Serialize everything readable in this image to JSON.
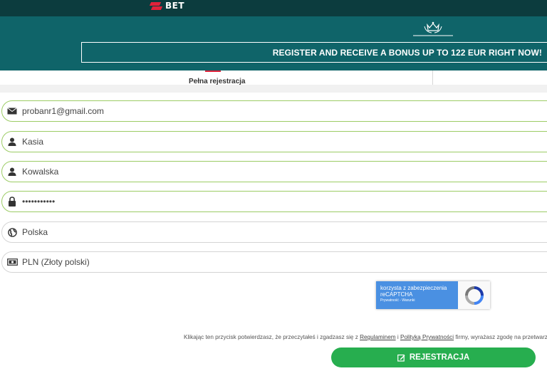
{
  "header": {
    "logo_text": "BET"
  },
  "banner": {
    "bonus_text": "REGISTER AND RECEIVE A BONUS UP TO 122 EUR RIGHT NOW!"
  },
  "tabs": {
    "full_registration": "Pełna rejestracja"
  },
  "form": {
    "email": {
      "value": "probanr1@gmail.com",
      "icon": "envelope-icon"
    },
    "first_name": {
      "value": "Kasia",
      "icon": "user-icon"
    },
    "last_name": {
      "value": "Kowalska",
      "icon": "user-icon"
    },
    "password": {
      "value": "•••••••••••",
      "icon": "lock-icon"
    },
    "country": {
      "value": "Polska",
      "icon": "globe-icon"
    },
    "currency": {
      "value": "PLN (Złoty polski)",
      "icon": "banknote-icon"
    }
  },
  "captcha": {
    "line1": "korzysta z zabezpieczenia",
    "line2": "reCAPTCHA",
    "line3": "Prywatność - Warunki"
  },
  "consent": {
    "prefix": "Klikając ten przycisk potwierdzasz, że przeczytałeś i zgadzasz się z",
    "terms_link": "Regulaminem",
    "and": "i",
    "privacy_link": "Polityką Prywatności",
    "suffix": "firmy, wyrażasz zgodę na przetwarzanie danych"
  },
  "submit": {
    "label": "REJESTRACJA",
    "icon": "edit-icon"
  },
  "colors": {
    "topbar": "#0c3c3e",
    "banner": "#0f6469",
    "accent": "#e0223a",
    "valid_border": "#9ccc65",
    "submit": "#27ae4f",
    "captcha": "#4a90e2"
  }
}
